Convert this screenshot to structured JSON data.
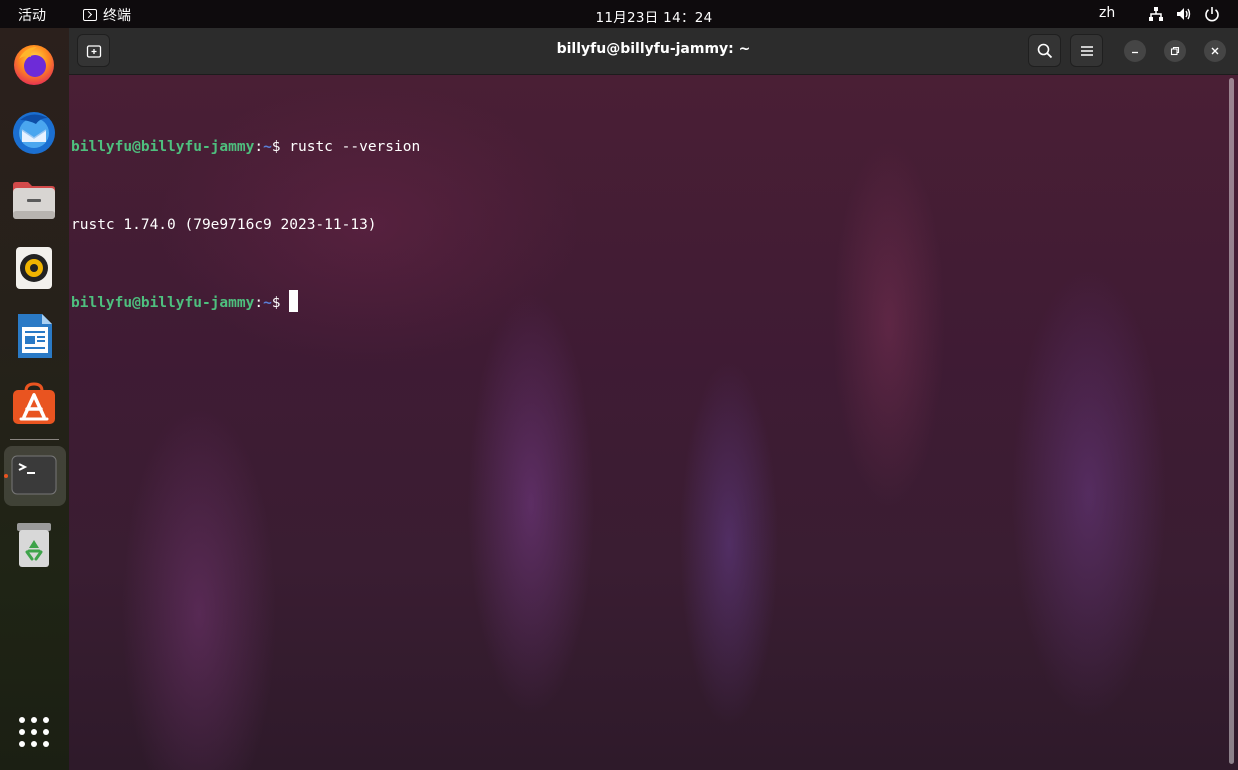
{
  "topbar": {
    "activities": "活动",
    "app_name": "终端",
    "clock": "11月23日  14：24",
    "lang": "zh",
    "icons": [
      "network-icon",
      "volume-icon",
      "power-icon"
    ]
  },
  "dock": {
    "items": [
      "firefox",
      "thunderbird",
      "files",
      "rhythmbox",
      "libreoffice-writer",
      "ubuntu-software",
      "terminal",
      "trash"
    ],
    "active_item": "terminal",
    "app_grid": "show-applications-icon",
    "accent": "#e95420"
  },
  "window": {
    "title": "billyfu@billyfu-jammy: ~"
  },
  "terminal": {
    "prompt_user": "billyfu@billyfu-jammy",
    "prompt_sep": ":",
    "prompt_path": "~",
    "prompt_symbol": "$",
    "line1_cmd": " rustc --version",
    "line2_output": "rustc 1.74.0 (79e9716c9 2023-11-13)",
    "colors": {
      "user": "#4ebf7e",
      "path": "#5a7fd6",
      "text": "#ffffff"
    }
  }
}
